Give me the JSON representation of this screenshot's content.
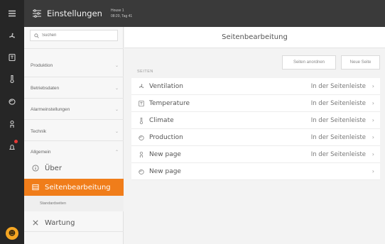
{
  "rail": {
    "icons": [
      "menu-icon",
      "ventilation-icon",
      "temperature-icon",
      "climate-icon",
      "production-icon",
      "person-icon",
      "alarm-icon",
      "avatar-icon"
    ]
  },
  "topbar": {
    "title": "Einstellungen",
    "user_line1": "House 1",
    "user_line2": "08:20, Tag 41"
  },
  "sidebar": {
    "search_placeholder": "Suchen",
    "categories": [
      {
        "label": "Produktion"
      },
      {
        "label": "Betriebsdaten"
      },
      {
        "label": "Alarmeinstellungen"
      },
      {
        "label": "Technik"
      },
      {
        "label": "Allgemein"
      }
    ],
    "items": [
      {
        "label": "Über"
      },
      {
        "label": "Seitenbearbeitung"
      },
      {
        "label": "Standardseiten"
      },
      {
        "label": "Wartung"
      }
    ]
  },
  "main": {
    "title": "Seitenbearbeitung",
    "btn_arrange": "Seiten anordnen",
    "btn_new": "Neue Seite",
    "section_label": "SEITEN",
    "pages": [
      {
        "name": "Ventilation",
        "status": "In der Seitenleiste",
        "icon": "ventilation-icon"
      },
      {
        "name": "Temperature",
        "status": "In der Seitenleiste",
        "icon": "temperature-icon"
      },
      {
        "name": "Climate",
        "status": "In der Seitenleiste",
        "icon": "climate-icon"
      },
      {
        "name": "Production",
        "status": "In der Seitenleiste",
        "icon": "production-icon"
      },
      {
        "name": "New page",
        "status": "In der Seitenleiste",
        "icon": "person-icon"
      },
      {
        "name": "New page",
        "status": "",
        "icon": "production-icon"
      }
    ]
  },
  "colors": {
    "accent": "#f07d1a",
    "rail": "#262626",
    "topbar": "#3a3a3a",
    "badge": "#e53935"
  }
}
